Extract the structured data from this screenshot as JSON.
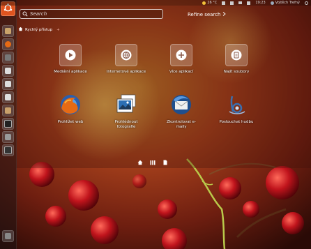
{
  "top_panel": {
    "temperature": "26 °C",
    "time": "19:23",
    "user": "Vojtěch Trefný"
  },
  "search": {
    "placeholder": "Search",
    "refine_label": "Refine search"
  },
  "category": {
    "label": "Rychlý přístup",
    "add_symbol": "+"
  },
  "shortcuts": [
    {
      "label": "Mediální aplikace",
      "icon": "play-icon"
    },
    {
      "label": "Internetové aplikace",
      "icon": "globe-icon"
    },
    {
      "label": "Více aplikací",
      "icon": "plus-icon"
    },
    {
      "label": "Najít soubory",
      "icon": "file-search-icon"
    }
  ],
  "apps": [
    {
      "label_line1": "Prohlížet web",
      "label_line2": "",
      "icon": "firefox-icon"
    },
    {
      "label_line1": "Prohlédnout",
      "label_line2": "fotografie",
      "icon": "photos-icon"
    },
    {
      "label_line1": "Zkontrolovat e-",
      "label_line2": "maily",
      "icon": "thunderbird-icon"
    },
    {
      "label_line1": "Poslouchat hudbu",
      "label_line2": "",
      "icon": "banshee-icon"
    }
  ],
  "lenses": [
    "home-lens-icon",
    "applications-lens-icon",
    "files-lens-icon"
  ],
  "launcher_items": [
    "home-folder-icon",
    "firefox-icon",
    "mail-icon",
    "writer-icon",
    "calc-icon",
    "impress-icon",
    "software-center-icon",
    "terminal-icon",
    "settings-icon",
    "workspace-switcher-icon",
    "trash-icon"
  ]
}
